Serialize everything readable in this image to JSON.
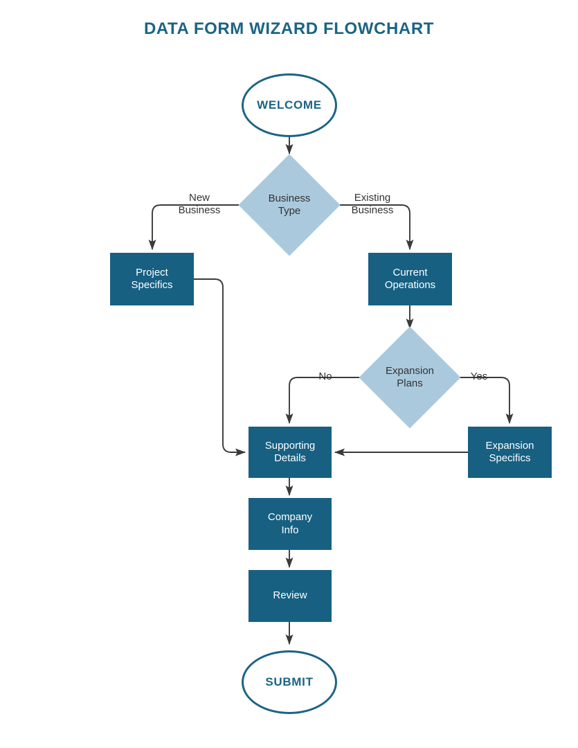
{
  "title": "DATA FORM WIZARD FLOWCHART",
  "colors": {
    "title": "#1b6485",
    "process_fill": "#176082",
    "process_text": "#ffffff",
    "decision_fill": "#aac9dd",
    "decision_text": "#333333",
    "terminal_border": "#1b6485",
    "terminal_text": "#1b6485",
    "terminal_fill": "#ffffff",
    "edge_line": "#3a3a3a",
    "edge_label_text": "#333333",
    "background": "#ffffff"
  },
  "nodes": {
    "welcome": {
      "label": "WELCOME",
      "shape": "ellipse"
    },
    "business_type": {
      "label_line1": "Business",
      "label_line2": "Type",
      "shape": "diamond"
    },
    "project_specifics": {
      "label_line1": "Project",
      "label_line2": "Specifics",
      "shape": "rectangle"
    },
    "current_operations": {
      "label_line1": "Current",
      "label_line2": "Operations",
      "shape": "rectangle"
    },
    "expansion_plans": {
      "label_line1": "Expansion",
      "label_line2": "Plans",
      "shape": "diamond"
    },
    "expansion_specifics": {
      "label_line1": "Expansion",
      "label_line2": "Specifics",
      "shape": "rectangle"
    },
    "supporting_details": {
      "label_line1": "Supporting",
      "label_line2": "Details",
      "shape": "rectangle"
    },
    "company_info": {
      "label_line1": "Company",
      "label_line2": "Info",
      "shape": "rectangle"
    },
    "review": {
      "label": "Review",
      "shape": "rectangle"
    },
    "submit": {
      "label": "SUBMIT",
      "shape": "ellipse"
    }
  },
  "edge_labels": {
    "new_business_line1": "New",
    "new_business_line2": "Business",
    "existing_business_line1": "Existing",
    "existing_business_line2": "Business",
    "expansion_no": "No",
    "expansion_yes": "Yes"
  },
  "chart_data": {
    "type": "diagram",
    "title": "DATA FORM WIZARD FLOWCHART",
    "diagram_kind": "flowchart",
    "orientation": "top-to-bottom",
    "nodes": [
      {
        "id": "welcome",
        "text": "WELCOME",
        "type": "terminal"
      },
      {
        "id": "business_type",
        "text": "Business Type",
        "type": "decision"
      },
      {
        "id": "project_specifics",
        "text": "Project Specifics",
        "type": "process"
      },
      {
        "id": "current_operations",
        "text": "Current Operations",
        "type": "process"
      },
      {
        "id": "expansion_plans",
        "text": "Expansion Plans",
        "type": "decision"
      },
      {
        "id": "expansion_specifics",
        "text": "Expansion Specifics",
        "type": "process"
      },
      {
        "id": "supporting_details",
        "text": "Supporting Details",
        "type": "process"
      },
      {
        "id": "company_info",
        "text": "Company Info",
        "type": "process"
      },
      {
        "id": "review",
        "text": "Review",
        "type": "process"
      },
      {
        "id": "submit",
        "text": "SUBMIT",
        "type": "terminal"
      }
    ],
    "edges": [
      {
        "from": "welcome",
        "to": "business_type",
        "label": ""
      },
      {
        "from": "business_type",
        "to": "project_specifics",
        "label": "New Business"
      },
      {
        "from": "business_type",
        "to": "current_operations",
        "label": "Existing Business"
      },
      {
        "from": "project_specifics",
        "to": "supporting_details",
        "label": ""
      },
      {
        "from": "current_operations",
        "to": "expansion_plans",
        "label": ""
      },
      {
        "from": "expansion_plans",
        "to": "supporting_details",
        "label": "No"
      },
      {
        "from": "expansion_plans",
        "to": "expansion_specifics",
        "label": "Yes"
      },
      {
        "from": "expansion_specifics",
        "to": "supporting_details",
        "label": ""
      },
      {
        "from": "supporting_details",
        "to": "company_info",
        "label": ""
      },
      {
        "from": "company_info",
        "to": "review",
        "label": ""
      },
      {
        "from": "review",
        "to": "submit",
        "label": ""
      }
    ]
  }
}
